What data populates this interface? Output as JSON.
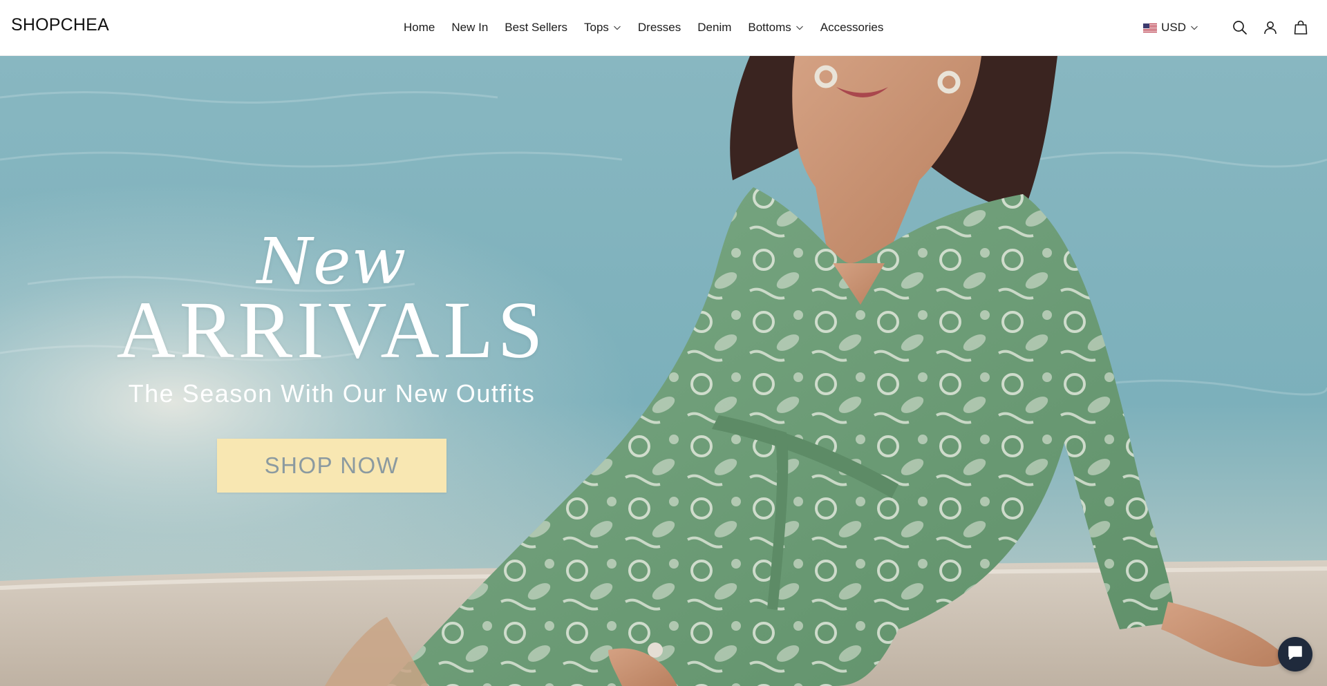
{
  "brand": {
    "logo_text": "SHOPCHEA"
  },
  "nav": {
    "items": [
      {
        "label": "Home",
        "has_dropdown": false
      },
      {
        "label": "New In",
        "has_dropdown": false
      },
      {
        "label": "Best Sellers",
        "has_dropdown": false
      },
      {
        "label": "Tops",
        "has_dropdown": true
      },
      {
        "label": "Dresses",
        "has_dropdown": false
      },
      {
        "label": "Denim",
        "has_dropdown": false
      },
      {
        "label": "Bottoms",
        "has_dropdown": true
      },
      {
        "label": "Accessories",
        "has_dropdown": false
      }
    ]
  },
  "header_right": {
    "currency": "USD",
    "currency_flag": "us-flag-icon",
    "icons": [
      "search-icon",
      "account-icon",
      "cart-bag-icon"
    ]
  },
  "hero": {
    "eyebrow": "New",
    "title": "ARRIVALS",
    "subtitle": "The Season With Our New Outfits",
    "cta_label": "SHOP NOW",
    "colors": {
      "water": "#7fb2bd",
      "dress_green": "#6f9f79",
      "cta_bg": "#f8e7b2",
      "cta_text": "#8b9aa0"
    }
  },
  "chat": {
    "icon": "chat-bubble-icon",
    "bg": "#1f2a3c"
  }
}
